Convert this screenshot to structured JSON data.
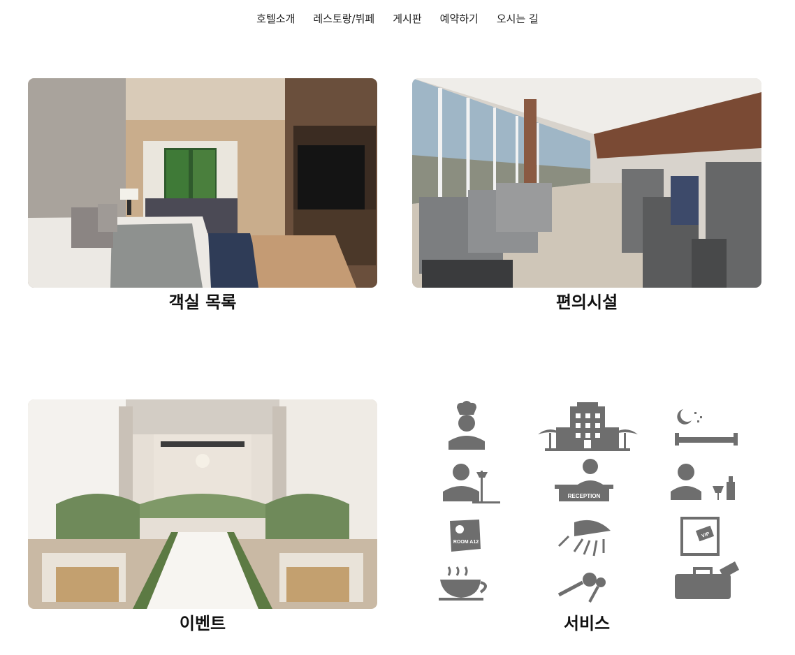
{
  "nav": {
    "items": [
      {
        "label": "호텔소개"
      },
      {
        "label": "레스토랑/뷔페"
      },
      {
        "label": "게시판"
      },
      {
        "label": "예약하기"
      },
      {
        "label": "오시는 길"
      }
    ]
  },
  "cards": {
    "rooms": {
      "caption": "객실 목록"
    },
    "facilities": {
      "caption": "편의시설"
    },
    "events": {
      "caption": "이벤트"
    },
    "services": {
      "caption": "서비스",
      "reception_sign": "RECEPTION",
      "room_tag": "ROOM A12",
      "vip_card": "VIP"
    }
  },
  "colors": {
    "icon_gray": "#6e6e6e",
    "caption_text": "#111111",
    "nav_text": "#222222"
  }
}
